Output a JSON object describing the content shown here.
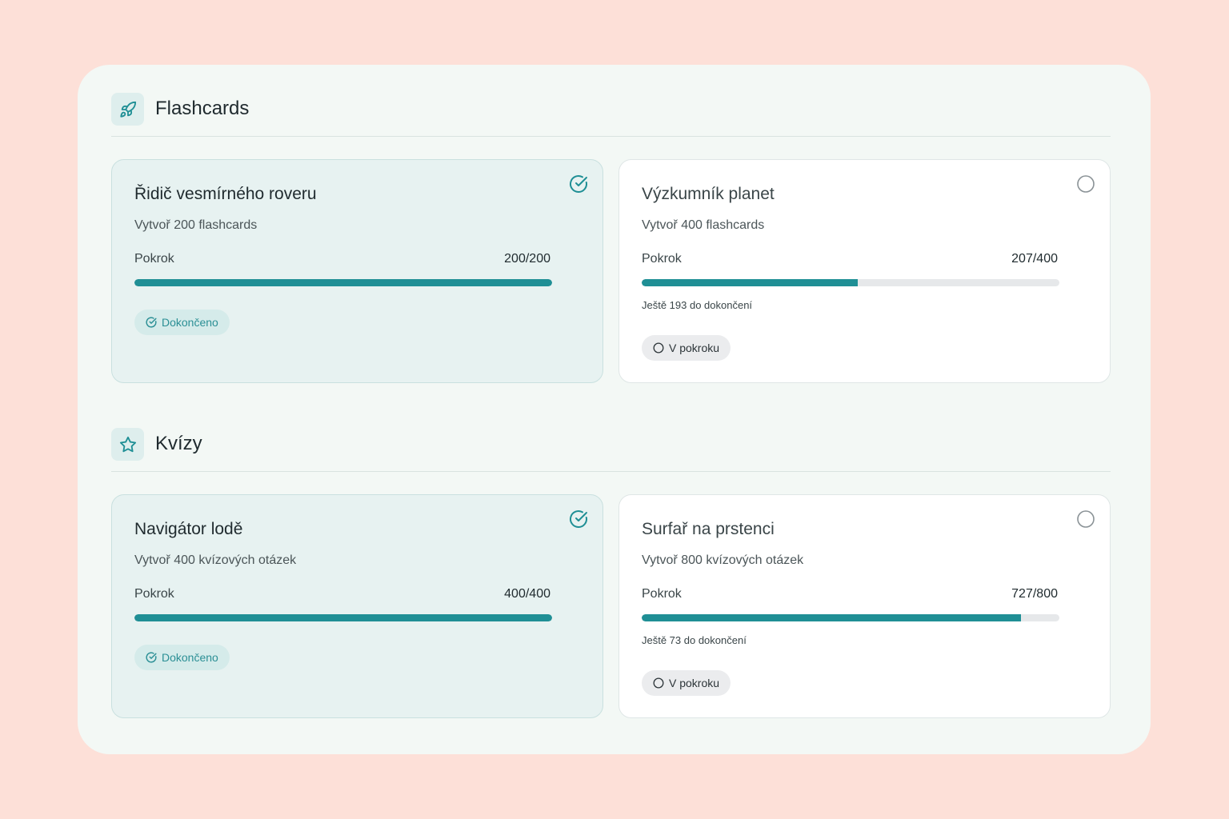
{
  "sections": [
    {
      "title": "Flashcards",
      "icon": "rocket-icon",
      "cards": [
        {
          "title": "Řidič vesmírného roveru",
          "description": "Vytvoř 200 flashcards",
          "progress_label": "Pokrok",
          "progress_text": "200/200",
          "progress_fraction": 1.0,
          "status_label": "Dokončeno",
          "completed": true
        },
        {
          "title": "Výzkumník planet",
          "description": "Vytvoř 400 flashcards",
          "progress_label": "Pokrok",
          "progress_text": "207/400",
          "progress_fraction": 0.5175,
          "remaining_text": "Ještě 193 do dokončení",
          "status_label": "V pokroku",
          "completed": false
        }
      ]
    },
    {
      "title": "Kvízy",
      "icon": "star-icon",
      "cards": [
        {
          "title": "Navigátor lodě",
          "description": "Vytvoř 400 kvízových otázek",
          "progress_label": "Pokrok",
          "progress_text": "400/400",
          "progress_fraction": 1.0,
          "status_label": "Dokončeno",
          "completed": true
        },
        {
          "title": "Surfař na prstenci",
          "description": "Vytvoř 800 kvízových otázek",
          "progress_label": "Pokrok",
          "progress_text": "727/800",
          "progress_fraction": 0.90875,
          "remaining_text": "Ještě 73 do dokončení",
          "status_label": "V pokroku",
          "completed": false
        }
      ]
    }
  ],
  "colors": {
    "accent": "#1f8f95",
    "page_background": "#fde0d8",
    "panel_background": "#f3f8f5",
    "completed_card": "#e7f2f1"
  }
}
